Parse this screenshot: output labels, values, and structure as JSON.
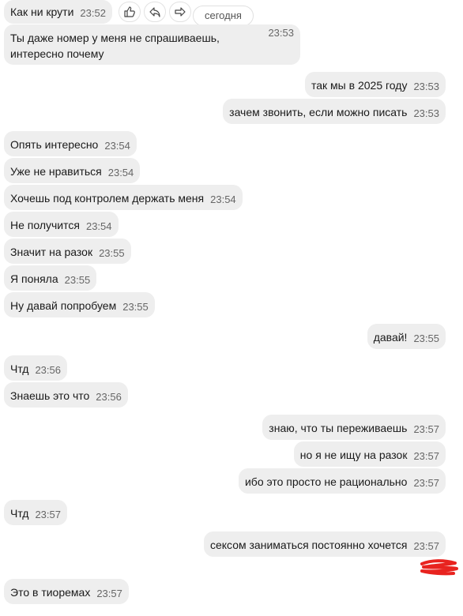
{
  "date_separator": "сегодня",
  "messages": [
    {
      "text": "Как ни крути",
      "time": "23:52"
    },
    {
      "text": "Ты даже номер у меня не спрашиваешь, интересно почему",
      "time": "23:53"
    },
    {
      "text": "так мы в 2025 году",
      "time": "23:53"
    },
    {
      "text": "зачем звонить, если можно писать",
      "time": "23:53"
    },
    {
      "text": "Опять интересно",
      "time": "23:54"
    },
    {
      "text": "Уже не нравиться",
      "time": "23:54"
    },
    {
      "text": "Хочешь под контролем держать меня",
      "time": "23:54"
    },
    {
      "text": "Не получится",
      "time": "23:54"
    },
    {
      "text": "Значит на разок",
      "time": "23:55"
    },
    {
      "text": "Я поняла",
      "time": "23:55"
    },
    {
      "text": "Ну давай попробуем",
      "time": "23:55"
    },
    {
      "text": "давай!",
      "time": "23:55"
    },
    {
      "text": "Чтд",
      "time": "23:56"
    },
    {
      "text": "Знаешь это что",
      "time": "23:56"
    },
    {
      "text": "знаю, что ты переживаешь",
      "time": "23:57"
    },
    {
      "text": "но я не ищу на разок",
      "time": "23:57"
    },
    {
      "text": "ибо это просто не рационально",
      "time": "23:57"
    },
    {
      "text": "Чтд",
      "time": "23:57"
    },
    {
      "text": "сексом заниматься постоянно хочется",
      "time": "23:57"
    },
    {
      "text": "Это в тиоремах",
      "time": "23:57"
    }
  ],
  "icons": {
    "like": "thumbs-up-icon",
    "reply": "reply-icon",
    "forward": "forward-icon"
  },
  "colors": {
    "bubble": "#eeeeee",
    "time": "#666666",
    "redaction": "#e8231f"
  }
}
